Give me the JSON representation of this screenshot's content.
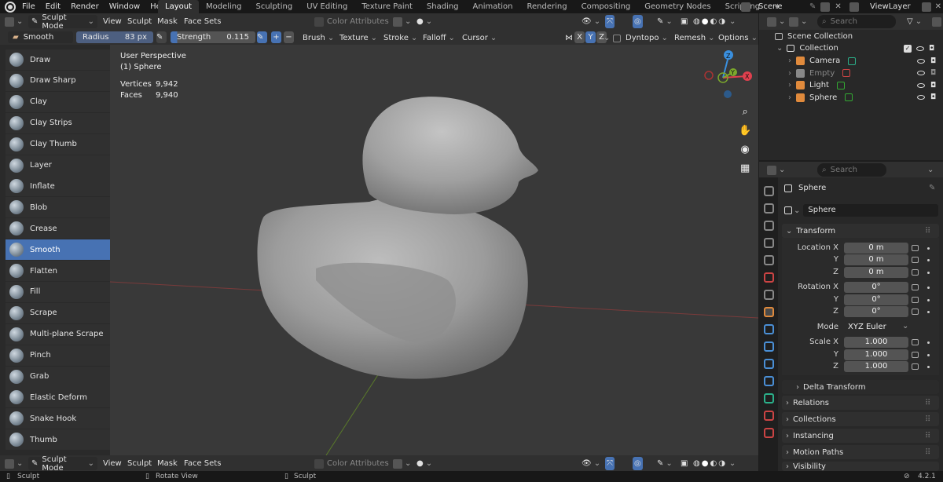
{
  "menu": {
    "file": "File",
    "edit": "Edit",
    "render": "Render",
    "window": "Window",
    "help": "Help"
  },
  "workspaces": [
    "Layout",
    "Modeling",
    "Sculpting",
    "UV Editing",
    "Texture Paint",
    "Shading",
    "Animation",
    "Rendering",
    "Compositing",
    "Geometry Nodes",
    "Scripting",
    "+"
  ],
  "active_workspace": "Layout",
  "scene": "Scene",
  "view_layer": "ViewLayer",
  "header": {
    "mode": "Sculpt Mode",
    "view": "View",
    "sculpt": "Sculpt",
    "mask": "Mask",
    "face_sets": "Face Sets",
    "color_attributes": "Color Attributes"
  },
  "toolsettings": {
    "brush_name": "Smooth",
    "radius_label": "Radius",
    "radius_value": "83 px",
    "strength_label": "Strength",
    "strength_value": "0.115",
    "brush": "Brush",
    "texture": "Texture",
    "stroke": "Stroke",
    "falloff": "Falloff",
    "cursor": "Cursor",
    "x": "X",
    "y": "Y",
    "z": "Z",
    "dyntopo": "Dyntopo",
    "remesh": "Remesh",
    "options": "Options"
  },
  "tools": [
    "Draw",
    "Draw Sharp",
    "Clay",
    "Clay Strips",
    "Clay Thumb",
    "Layer",
    "Inflate",
    "Blob",
    "Crease",
    "Smooth",
    "Flatten",
    "Fill",
    "Scrape",
    "Multi-plane Scrape",
    "Pinch",
    "Grab",
    "Elastic Deform",
    "Snake Hook",
    "Thumb"
  ],
  "active_tool": "Smooth",
  "viewport": {
    "perspective": "User Perspective",
    "object": "(1) Sphere",
    "vertices_label": "Vertices",
    "vertices": "9,942",
    "faces_label": "Faces",
    "faces": "9,940"
  },
  "gizmo": {
    "x": "X",
    "y": "Y",
    "z": "Z"
  },
  "outliner": {
    "search": "Search",
    "scene_collection": "Scene Collection",
    "collection": "Collection",
    "items": [
      "Camera",
      "Empty",
      "Light",
      "Sphere"
    ]
  },
  "properties": {
    "search": "Search",
    "object_name": "Sphere",
    "data_name": "Sphere",
    "transform": "Transform",
    "location_label": "Location X",
    "loc": [
      "0 m",
      "0 m",
      "0 m"
    ],
    "rotation_label": "Rotation X",
    "rot": [
      "0°",
      "0°",
      "0°"
    ],
    "mode_label": "Mode",
    "mode": "XYZ Euler",
    "scale_label": "Scale X",
    "scale": [
      "1.000",
      "1.000",
      "1.000"
    ],
    "y": "Y",
    "z": "Z",
    "delta": "Delta Transform",
    "relations": "Relations",
    "collections": "Collections",
    "instancing": "Instancing",
    "motion": "Motion Paths",
    "visibility": "Visibility"
  },
  "status": {
    "left": "Sculpt",
    "mid": "Rotate View",
    "right": "Sculpt",
    "version": "4.2.1"
  },
  "colors": {
    "accent": "#4772b3",
    "x_axis": "#e0404e",
    "y_axis": "#7ca82c",
    "z_axis": "#3a8fde"
  }
}
